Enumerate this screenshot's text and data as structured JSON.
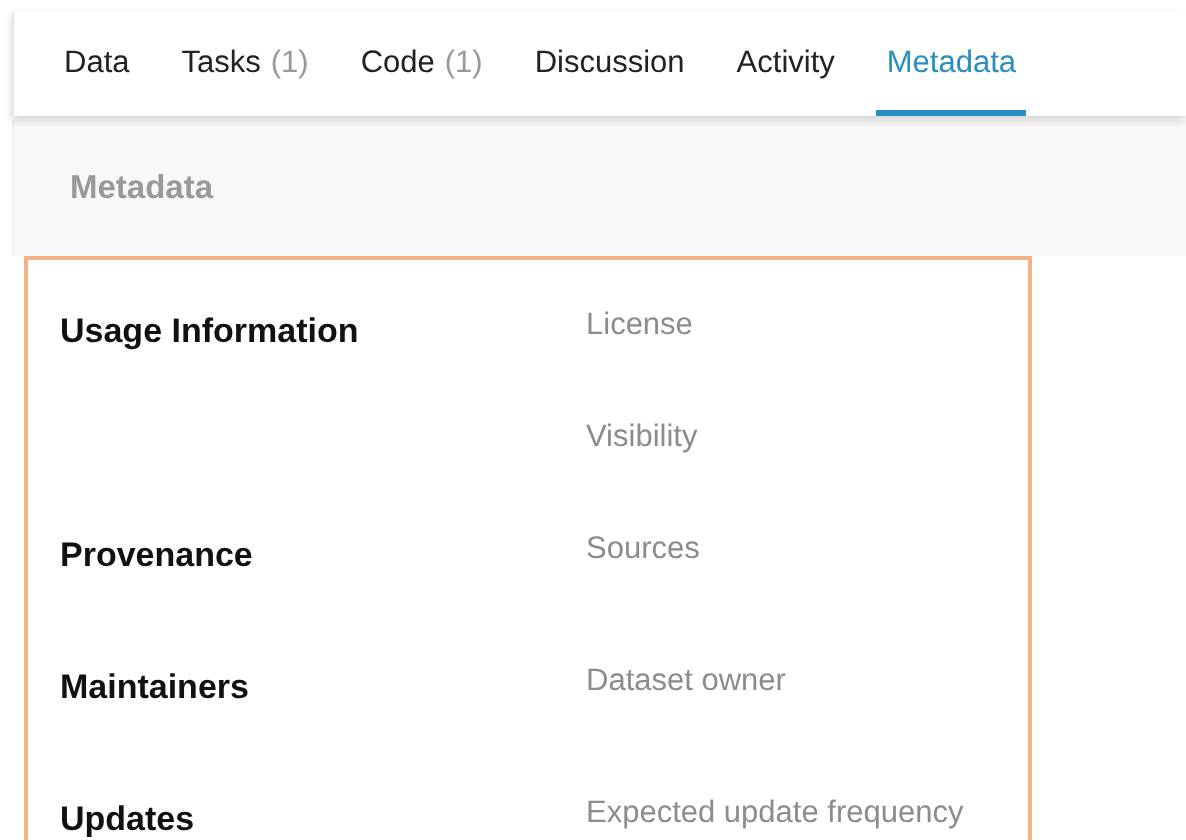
{
  "tabs": [
    {
      "label": "Data",
      "selected": false
    },
    {
      "label": "Tasks",
      "count": "(1)",
      "selected": false
    },
    {
      "label": "Code",
      "count": "(1)",
      "selected": false
    },
    {
      "label": "Discussion",
      "selected": false
    },
    {
      "label": "Activity",
      "selected": false
    },
    {
      "label": "Metadata",
      "selected": true
    }
  ],
  "header": {
    "title": "Metadata"
  },
  "sections": [
    {
      "title": "Usage Information",
      "fields": [
        "License",
        "Visibility"
      ]
    },
    {
      "title": "Provenance",
      "fields": [
        "Sources"
      ]
    },
    {
      "title": "Maintainers",
      "fields": [
        "Dataset owner"
      ]
    },
    {
      "title": "Updates",
      "fields": [
        "Expected update frequency"
      ]
    }
  ]
}
